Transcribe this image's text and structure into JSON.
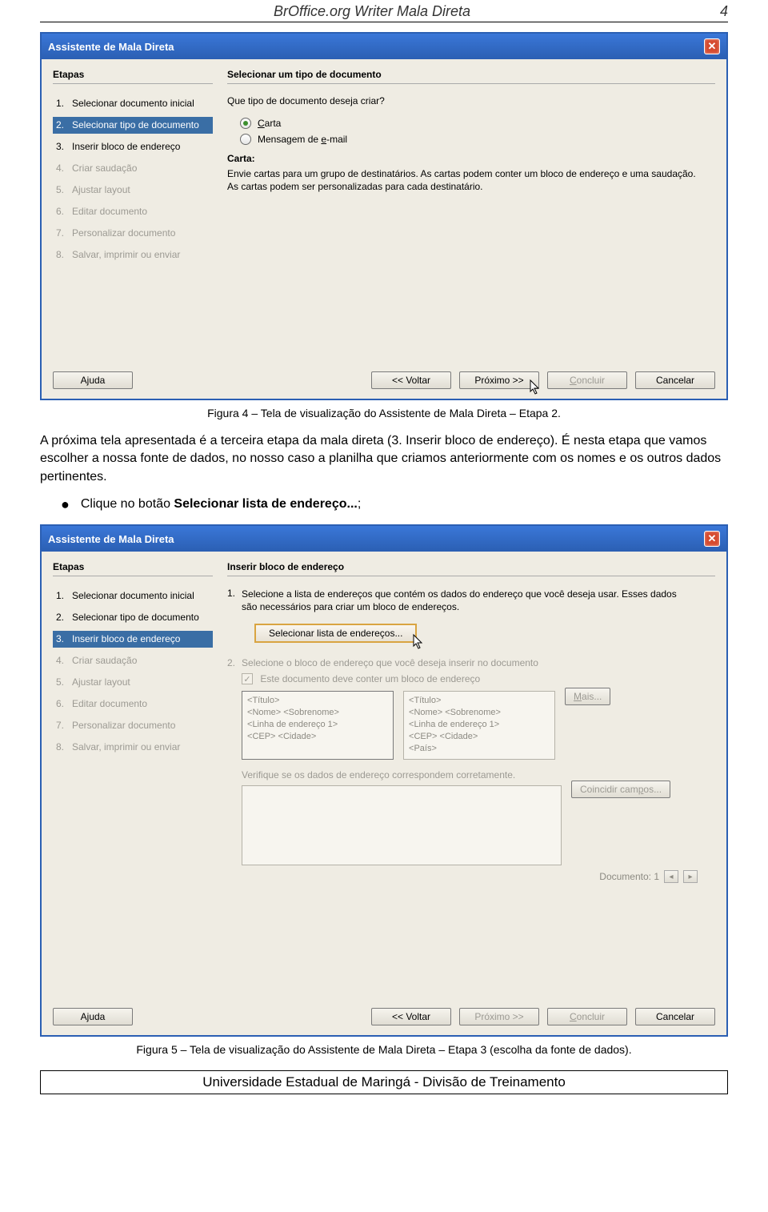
{
  "doc": {
    "header_title": "BrOffice.org Writer Mala Direta",
    "page_num": "4",
    "footer": "Universidade Estadual de Maringá - Divisão de Treinamento"
  },
  "wizard1": {
    "title": "Assistente de Mala Direta",
    "steps_heading": "Etapas",
    "right_heading": "Selecionar um tipo de documento",
    "steps": [
      {
        "num": "1.",
        "label": "Selecionar documento inicial"
      },
      {
        "num": "2.",
        "label": "Selecionar tipo de documento"
      },
      {
        "num": "3.",
        "label": "Inserir bloco de endereço"
      },
      {
        "num": "4.",
        "label": "Criar saudação"
      },
      {
        "num": "5.",
        "label": "Ajustar layout"
      },
      {
        "num": "6.",
        "label": "Editar documento"
      },
      {
        "num": "7.",
        "label": "Personalizar documento"
      },
      {
        "num": "8.",
        "label": "Salvar, imprimir ou enviar"
      }
    ],
    "question": "Que tipo de documento deseja criar?",
    "radio_carta": "Carta",
    "radio_email": "Mensagem de e-mail",
    "desc_title": "Carta:",
    "desc_body": "Envie cartas para um grupo de destinatários. As cartas podem conter um bloco de endereço e uma saudação. As cartas podem ser personalizadas para cada destinatário.",
    "buttons": {
      "help": "Ajuda",
      "back": "<< Voltar",
      "next": "Próximo >>",
      "finish": "Concluir",
      "cancel": "Cancelar"
    }
  },
  "caption1": "Figura 4 – Tela de visualização do Assistente de Mala Direta – Etapa 2.",
  "para1": "A próxima tela apresentada é a terceira etapa da mala direta (3. Inserir bloco de endereço). É nesta etapa que vamos escolher a nossa fonte de dados, no nosso caso a planilha que criamos anteriormente com os nomes e os outros dados pertinentes.",
  "bullet1_pre": "Clique no botão ",
  "bullet1_bold": "Selecionar lista de endereço...",
  "bullet1_post": ";",
  "wizard2": {
    "title": "Assistente de Mala Direta",
    "steps_heading": "Etapas",
    "right_heading": "Inserir bloco de endereço",
    "steps": [
      {
        "num": "1.",
        "label": "Selecionar documento inicial"
      },
      {
        "num": "2.",
        "label": "Selecionar tipo de documento"
      },
      {
        "num": "3.",
        "label": "Inserir bloco de endereço"
      },
      {
        "num": "4.",
        "label": "Criar saudação"
      },
      {
        "num": "5.",
        "label": "Ajustar layout"
      },
      {
        "num": "6.",
        "label": "Editar documento"
      },
      {
        "num": "7.",
        "label": "Personalizar documento"
      },
      {
        "num": "8.",
        "label": "Salvar, imprimir ou enviar"
      }
    ],
    "sec1_num": "1.",
    "sec1_text": "Selecione a lista de endereços que contém os dados do endereço que você deseja usar. Esses dados são necessários para criar um bloco de endereços.",
    "select_btn": "Selecionar lista de endereços...",
    "sec2_num": "2.",
    "sec2_text": "Selecione o bloco de endereço que você deseja inserir no documento",
    "chk_text": "Este documento deve conter um bloco de endereço",
    "addr1": "<Título>\n<Nome> <Sobrenome>\n<Linha de endereço 1>\n<CEP> <Cidade>",
    "addr2": "<Título>\n<Nome> <Sobrenome>\n<Linha de endereço 1>\n<CEP> <Cidade>\n<País>",
    "mais": "Mais...",
    "verify": "Verifique se os dados de endereço correspondem corretamente.",
    "coincidir": "Coincidir campos...",
    "doc_label": "Documento: 1",
    "buttons": {
      "help": "Ajuda",
      "back": "<< Voltar",
      "next": "Próximo >>",
      "finish": "Concluir",
      "cancel": "Cancelar"
    }
  },
  "caption2": "Figura 5 – Tela de visualização do Assistente de Mala Direta – Etapa 3 (escolha da fonte de dados)."
}
